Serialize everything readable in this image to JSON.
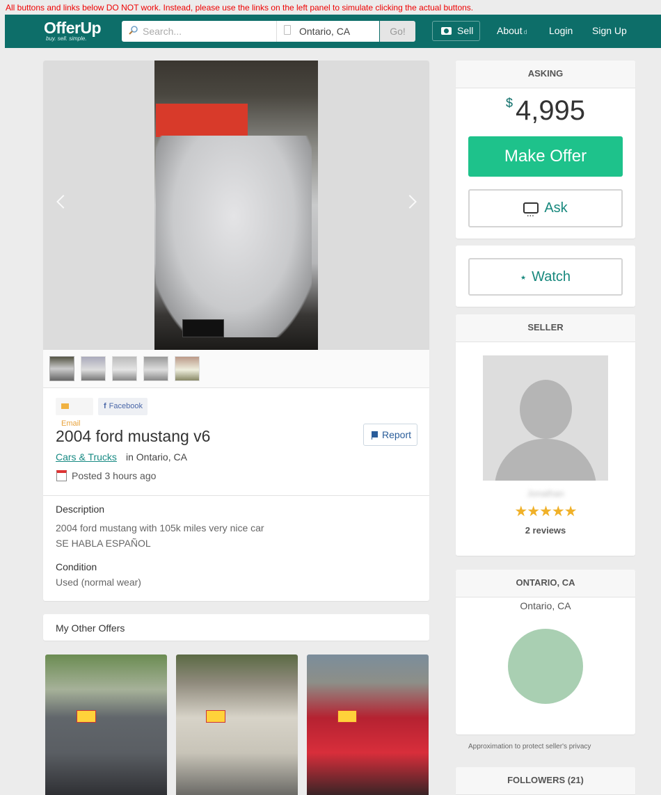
{
  "notice": "All buttons and links below DO NOT work. Instead, please use the links on the left panel to simulate clicking the actual buttons.",
  "header": {
    "logo": "OfferUp",
    "tagline": "buy. sell. simple.",
    "search_placeholder": "Search...",
    "location": "Ontario, CA",
    "go": "Go!",
    "sell": "Sell",
    "about": "About",
    "about_marker": "d",
    "login": "Login",
    "signup": "Sign Up"
  },
  "listing": {
    "share_email": "Email",
    "share_facebook": "Facebook",
    "title": "2004 ford mustang v6",
    "report": "Report",
    "category": "Cars & Trucks",
    "location": "in Ontario, CA",
    "posted": "Posted 3 hours ago",
    "description_label": "Description",
    "description_lines": [
      "2004 ford mustang with 105k miles very nice car",
      "SE HABLA ESPAÑOL"
    ],
    "condition_label": "Condition",
    "condition": "Used (normal wear)",
    "other_offers": "My Other Offers"
  },
  "sidebar": {
    "asking_label": "ASKING",
    "currency": "$",
    "price": "4,995",
    "make_offer": "Make Offer",
    "ask": "Ask",
    "watch": "Watch",
    "seller_label": "SELLER",
    "seller_name": "Jonathan",
    "rating": "★★★★★",
    "reviews": "2 reviews",
    "location_label": "ONTARIO, CA",
    "location_sub": "Ontario, CA",
    "privacy_note": "Approximation to protect seller's privacy",
    "followers": "FOLLOWERS (21)"
  },
  "colors": {
    "brand_teal": "#0d6e69",
    "offer_green": "#1ec28b",
    "link_teal": "#17887d",
    "star": "#f0b129",
    "map_circle": "#a9cfb2"
  }
}
